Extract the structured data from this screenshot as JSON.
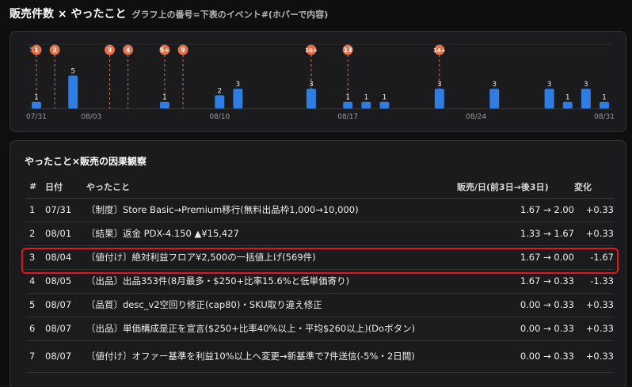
{
  "header": {
    "title": "販売件数 × やったこと",
    "subtitle": "グラフ上の番号=下表のイベント#(ホバーで内容)"
  },
  "chart_data": {
    "type": "bar",
    "categories": [
      "07/31",
      "08/01",
      "08/02",
      "08/03",
      "08/04",
      "08/05",
      "08/06",
      "08/07",
      "08/08",
      "08/09",
      "08/10",
      "08/11",
      "08/12",
      "08/13",
      "08/14",
      "08/15",
      "08/16",
      "08/17",
      "08/18",
      "08/19",
      "08/20",
      "08/21",
      "08/22",
      "08/23",
      "08/24",
      "08/25",
      "08/26",
      "08/27",
      "08/28",
      "08/29",
      "08/30",
      "08/31"
    ],
    "values": [
      1,
      0,
      5,
      0,
      0,
      0,
      0,
      1,
      0,
      0,
      2,
      3,
      0,
      0,
      0,
      3,
      0,
      1,
      1,
      1,
      0,
      0,
      3,
      0,
      0,
      3,
      0,
      0,
      3,
      1,
      3,
      1
    ],
    "x_tick_labels": [
      "07/31",
      "08/03",
      "08/10",
      "08/17",
      "08/24",
      "08/31"
    ],
    "color": "#2f7de1",
    "marker_color": "#e0714a",
    "event_markers": [
      {
        "label": "1",
        "date": "07/31"
      },
      {
        "label": "2",
        "date": "08/01"
      },
      {
        "label": "3",
        "date": "08/04"
      },
      {
        "label": "4",
        "date": "08/05"
      },
      {
        "label": "5+",
        "date": "08/07"
      },
      {
        "label": "9",
        "date": "08/08"
      },
      {
        "label": "10+",
        "date": "08/15"
      },
      {
        "label": "13",
        "date": "08/17"
      },
      {
        "label": "14+",
        "date": "08/22"
      }
    ],
    "edge_label": "5"
  },
  "table": {
    "title": "やったこと×販売の因果観察",
    "columns": [
      "#",
      "日付",
      "やったこと",
      "販売/日(前3日→後3日)",
      "変化"
    ],
    "rows": [
      {
        "num": "1",
        "date": "07/31",
        "action": "〔制度〕Store Basic→Premium移行(無料出品枠1,000→10,000)",
        "sales": "1.67 → 2.00",
        "change": "+0.33",
        "dir": "pos"
      },
      {
        "num": "2",
        "date": "08/01",
        "action": "〔結果〕返金 PDX-4.150 ▲¥15,427",
        "sales": "1.33 → 1.67",
        "change": "+0.33",
        "dir": "pos"
      },
      {
        "num": "3",
        "date": "08/04",
        "action": "〔値付け〕絶対利益フロア¥2,500の一括値上げ(569件)",
        "sales": "1.67 → 0.00",
        "change": "-1.67",
        "dir": "neg"
      },
      {
        "num": "4",
        "date": "08/05",
        "action": "〔出品〕出品353件(8月最多・$250+比率15.6%と低単価寄り)",
        "sales": "1.67 → 0.33",
        "change": "-1.33",
        "dir": "neg"
      },
      {
        "num": "5",
        "date": "08/07",
        "action": "〔品質〕desc_v2空回り修正(cap80)・SKU取り違え修正",
        "sales": "0.00 → 0.33",
        "change": "+0.33",
        "dir": "pos"
      },
      {
        "num": "6",
        "date": "08/07",
        "action": "〔出品〕単価構成是正を宣言($250+比率40%以上・平均$260以上)(Doボタン)",
        "sales": "0.00 → 0.33",
        "change": "+0.33",
        "dir": "pos"
      },
      {
        "num": "7",
        "date": "08/07",
        "action": "〔値付け〕オファー基準を利益10%以上へ変更→新基準で7件送信(-5%・2日間)",
        "sales": "0.00 → 0.33",
        "change": "+0.33",
        "dir": "pos"
      }
    ]
  }
}
